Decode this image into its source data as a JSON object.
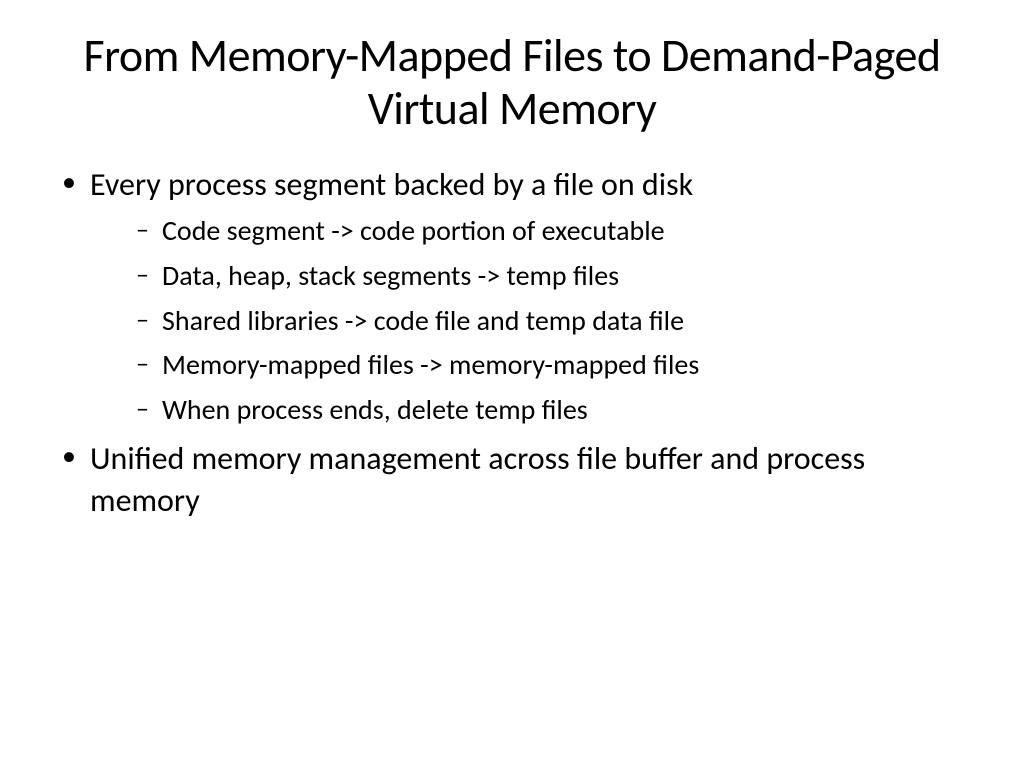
{
  "title": "From Memory-Mapped Files to Demand-Paged Virtual Memory",
  "bullets": {
    "b1": "Every process segment backed by a file on disk",
    "b1_subs": {
      "s1": "Code segment -> code portion of executable",
      "s2": "Data, heap, stack segments -> temp files",
      "s3": "Shared libraries -> code file and temp data file",
      "s4": "Memory-mapped files -> memory-mapped files",
      "s5": "When process ends, delete temp files"
    },
    "b2": "Unified memory management across file buffer and process memory"
  }
}
